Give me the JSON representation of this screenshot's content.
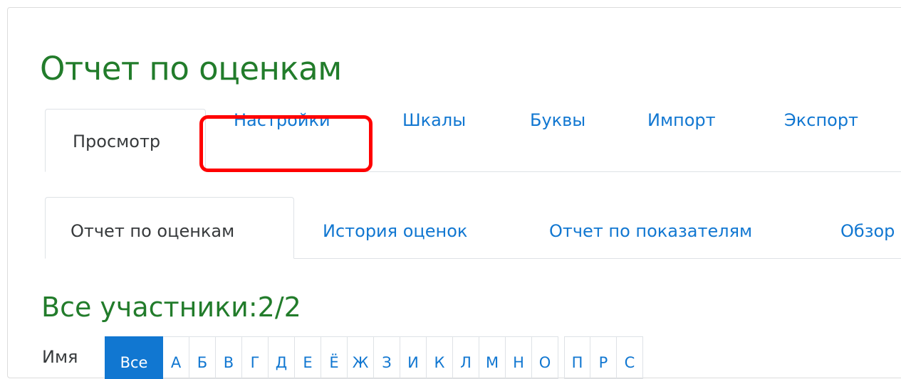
{
  "page_title": "Отчет по оценкам",
  "main_tabs": [
    {
      "label": "Просмотр",
      "active": true
    },
    {
      "label": "Настройки",
      "active": false,
      "highlighted": true
    },
    {
      "label": "Шкалы",
      "active": false
    },
    {
      "label": "Буквы",
      "active": false
    },
    {
      "label": "Импорт",
      "active": false
    },
    {
      "label": "Экспорт",
      "active": false
    }
  ],
  "sub_tabs": [
    {
      "label": "Отчет по оценкам",
      "active": true
    },
    {
      "label": "История оценок",
      "active": false
    },
    {
      "label": "Отчет по показателям",
      "active": false
    },
    {
      "label": "Обзор",
      "active": false
    }
  ],
  "participants_title": "Все участники:2/2",
  "initials_filter": {
    "label": "Имя",
    "letters": [
      "Все",
      "А",
      "Б",
      "В",
      "Г",
      "Д",
      "Е",
      "Ё",
      "Ж",
      "З",
      "И",
      "К",
      "Л",
      "М",
      "Н",
      "О",
      "П",
      "Р",
      "С"
    ],
    "selected": "Все"
  },
  "colors": {
    "title_green": "#227c2b",
    "link_blue": "#1177d1",
    "highlight_red": "#ff0000",
    "text_dark": "#373a3c"
  }
}
